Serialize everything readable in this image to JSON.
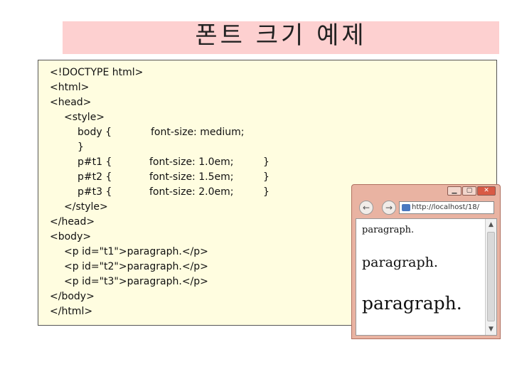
{
  "slide": {
    "title": "폰트 크기 예제"
  },
  "code": {
    "lines": [
      "<!DOCTYPE html>",
      "<html>",
      "<head>",
      "<style>",
      "body {",
      "font-size: medium;",
      "}",
      "p#t1 {",
      "font-size: 1.0em;",
      "}",
      "p#t2 {",
      "font-size: 1.5em;",
      "}",
      "p#t3 {",
      "font-size: 2.0em;",
      "}",
      "</style>",
      "</head>",
      "<body>",
      "<p id=\"t1\">paragraph.</p>",
      "<p id=\"t2\">paragraph.</p>",
      "<p id=\"t3\">paragraph.</p>",
      "</body>",
      "</html>"
    ]
  },
  "browser": {
    "address": "http://localhost/18/",
    "back_icon": "back-arrow-icon",
    "forward_icon": "forward-arrow-icon",
    "paragraphs": [
      "paragraph.",
      "paragraph.",
      "paragraph."
    ],
    "colors": {
      "frame": "#e9b3a2",
      "close": "#d85a45"
    }
  },
  "colors": {
    "title_bg": "#fdd0d0",
    "code_bg": "#fffde0"
  }
}
